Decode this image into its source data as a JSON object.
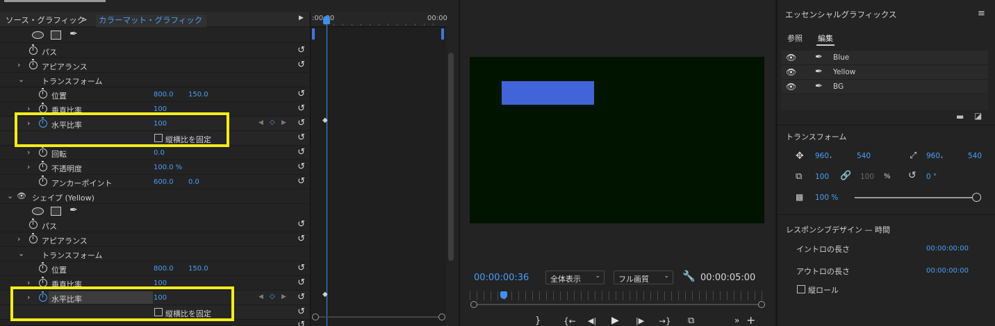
{
  "effect_controls": {
    "tab_source": "ソース・グラフィック",
    "tab_active": "カラーマット・グラフィック",
    "time_start": ":00:00",
    "time_end": "00:00",
    "section1": {
      "path": "パス",
      "appearance": "アピアランス",
      "transform": "トランスフォーム",
      "position_label": "位置",
      "position_x": "800.0",
      "position_y": "150.0",
      "vscale_label": "垂直比率",
      "vscale_value": "100",
      "hscale_label": "水平比率",
      "hscale_value": "100",
      "lock_ratio_label": "縦横比を固定",
      "rotation_label": "回転",
      "rotation_value": "0.0",
      "opacity_label": "不透明度",
      "opacity_value": "100.0 %",
      "anchor_label": "アンカーポイント",
      "anchor_x": "600.0",
      "anchor_y": "0.0"
    },
    "section2": {
      "shape_label": "シェイプ (Yellow)",
      "path": "パス",
      "appearance": "アピアランス",
      "transform": "トランスフォーム",
      "position_label": "位置",
      "position_x": "800.0",
      "position_y": "150.0",
      "vscale_label": "垂直比率",
      "vscale_value": "100",
      "hscale_label": "水平比率",
      "hscale_value": "100",
      "lock_ratio_label": "縦横比を固定"
    }
  },
  "program_monitor": {
    "current_time": "00:00:00:36",
    "zoom_select": "全体表示",
    "quality_select": "フル画質",
    "duration": "00:00:05:00",
    "video_bg_color": "#001400",
    "blue_rect_color": "#4164d8"
  },
  "essential_graphics": {
    "title": "エッセンシャルグラフィックス",
    "tab_browse": "参照",
    "tab_edit": "編集",
    "layers": [
      {
        "name": "Blue"
      },
      {
        "name": "Yellow"
      },
      {
        "name": "BG"
      }
    ],
    "transform_title": "トランスフォーム",
    "pos_x": "960",
    "pos_y": "540",
    "anchor_x": "960",
    "anchor_y": "540",
    "scale": "100",
    "scale_locked": "100",
    "percent": "%",
    "rotation": "0 °",
    "opacity": "100 %",
    "responsive_title": "レスポンシブデザイン — 時間",
    "intro_label": "イントロの長さ",
    "intro_value": "00:00:00:00",
    "outro_label": "アウトロの長さ",
    "outro_value": "00:00:00:00",
    "roll_label": "縦ロール"
  },
  "colors": {
    "accent": "#4a9ff5",
    "highlight": "#f2ec1c"
  }
}
